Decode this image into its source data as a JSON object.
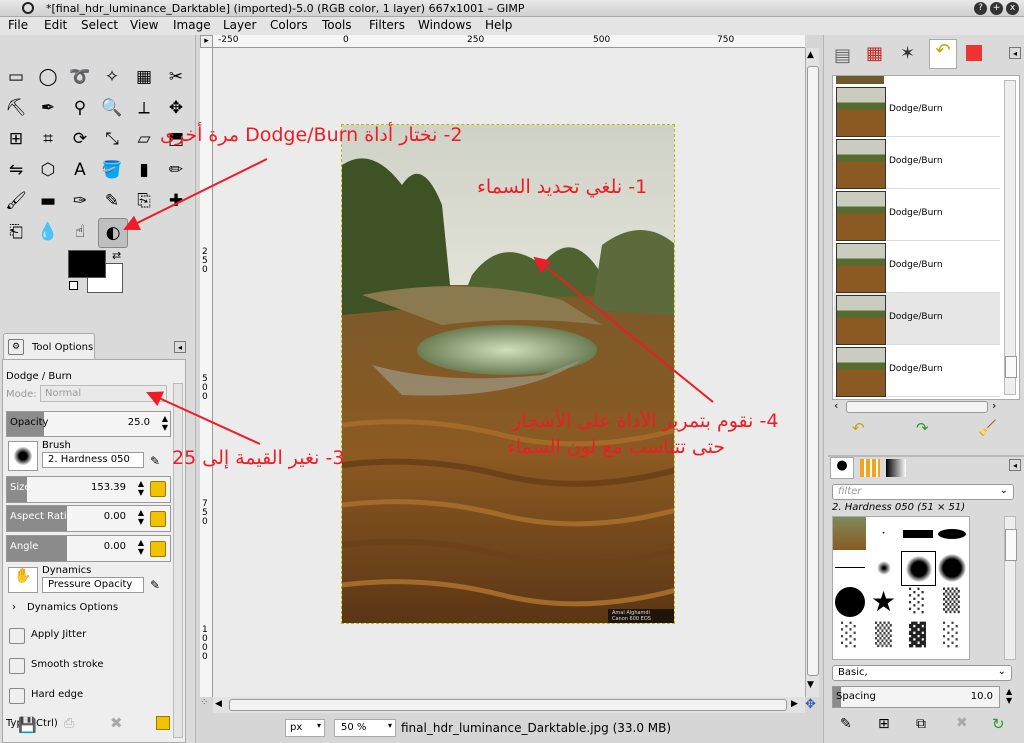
{
  "window": {
    "title": "*[final_hdr_luminance_Darktable] (imported)-5.0 (RGB color, 1 layer) 667x1001 – GIMP",
    "buttons": [
      "?",
      "+",
      "x"
    ]
  },
  "menu": [
    "File",
    "Edit",
    "Select",
    "View",
    "Image",
    "Layer",
    "Colors",
    "Tools",
    "Filters",
    "Windows",
    "Help"
  ],
  "toolbox": {
    "icons": [
      "rect-select-icon",
      "ellipse-select-icon",
      "free-select-icon",
      "fuzzy-select-icon",
      "color-select-icon",
      "scissors-icon",
      "foreground-select-icon",
      "paths-icon",
      "color-picker-icon",
      "zoom-icon",
      "measure-icon",
      "move-icon",
      "align-icon",
      "crop-icon",
      "rotate-icon",
      "scale-icon",
      "shear-icon",
      "perspective-icon",
      "flip-icon",
      "cage-icon",
      "text-icon",
      "bucket-fill-icon",
      "blend-icon",
      "pencil-icon",
      "paintbrush-icon",
      "eraser-icon",
      "airbrush-icon",
      "ink-icon",
      "clone-icon",
      "heal-icon",
      "perspective-clone-icon",
      "blur-icon",
      "smudge-icon",
      "dodge-burn-icon"
    ],
    "active": "dodge-burn-icon"
  },
  "tool_options": {
    "tab_label": "Tool Options",
    "tool_name": "Dodge / Burn",
    "mode_label": "Mode:",
    "mode_value": "Normal",
    "opacity_label": "Opacity",
    "opacity_value": "25.0",
    "opacity_fraction": 0.25,
    "brush_label": "Brush",
    "brush_value": "2. Hardness 050",
    "size_label": "Size",
    "size_value": "153.39",
    "aspect_label": "Aspect Ratio",
    "aspect_value": "0.00",
    "angle_label": "Angle",
    "angle_value": "0.00",
    "dynamics_label": "Dynamics",
    "dynamics_value": "Pressure Opacity",
    "dynamics_options": "Dynamics Options",
    "apply_jitter": "Apply Jitter",
    "smooth_stroke": "Smooth stroke",
    "hard_edge": "Hard edge",
    "type_label": "Type  (Ctrl)"
  },
  "rulers": {
    "h_ticks": [
      "-250",
      "0",
      "250",
      "500",
      "750"
    ],
    "v_ticks": [
      "2\n5\n0",
      "5\n0\n0",
      "7\n5\n0",
      "1\n0\n0\n0"
    ]
  },
  "status": {
    "unit": "px",
    "zoom": "50 %",
    "file_info": "final_hdr_luminance_Darktable.jpg (33.0 MB)"
  },
  "image": {
    "watermark_line1": "Amal Alghamdi",
    "watermark_line2": "Canon 600 EOS"
  },
  "annotations": {
    "step1": "1- نلغي تحديد السماء",
    "step2": "2- نختار أداة Dodge/Burn مرة أخرى",
    "step3": "3- نغير القيمة إلى 25",
    "step4_line1": "4- نقوم بتمرير الأداة على الأشجار",
    "step4_line2": "حتى تتناسب مع لون السماء"
  },
  "layers": {
    "rows": [
      "Dodge/Burn",
      "Dodge/Burn",
      "Dodge/Burn",
      "Dodge/Burn",
      "Dodge/Burn",
      "Dodge/Burn"
    ],
    "selected_index": 4
  },
  "brushes": {
    "filter_placeholder": "filter",
    "current": "2. Hardness 050 (51 × 51)",
    "preset": "Basic,",
    "spacing_label": "Spacing",
    "spacing_value": "10.0"
  },
  "colors": {
    "annotation": "#ee1c24",
    "foreground": "#000000",
    "background": "#ffffff"
  }
}
